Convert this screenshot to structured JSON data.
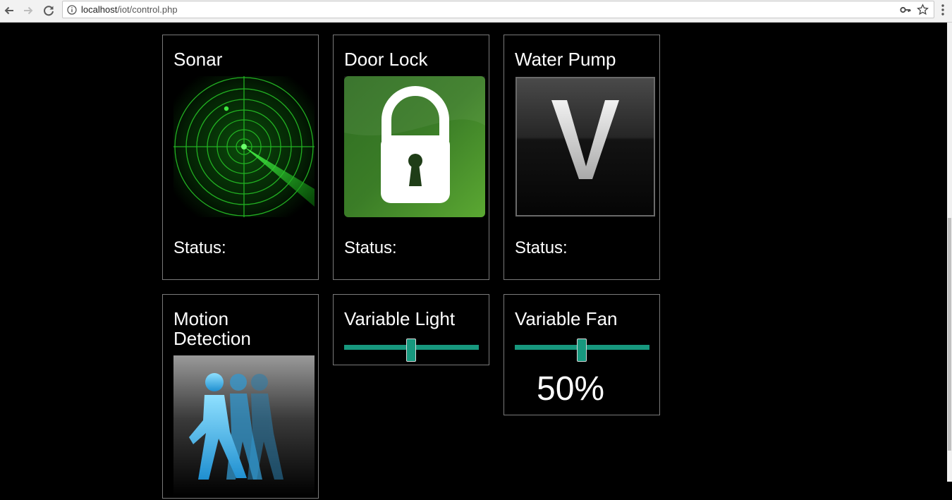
{
  "browser": {
    "url_host": "localhost",
    "url_path": "/iot/control.php",
    "icons": [
      "back-arrow-icon",
      "forward-arrow-icon",
      "reload-icon",
      "info-icon",
      "key-icon",
      "star-icon",
      "kebab-menu-icon"
    ]
  },
  "cards": {
    "sonar": {
      "title": "Sonar",
      "status_label": "Status:",
      "icon": "radar-icon"
    },
    "door_lock": {
      "title": "Door Lock",
      "status_label": "Status:",
      "icon": "padlock-icon"
    },
    "water_pump": {
      "title": "Water Pump",
      "status_label": "Status:",
      "icon": "letter-v-icon"
    },
    "motion": {
      "title_line1": "Motion",
      "title_line2": "Detection",
      "icon": "running-people-icon"
    },
    "variable_light": {
      "title": "Variable Light",
      "level_fraction": 0.5
    },
    "variable_fan": {
      "title": "Variable Fan",
      "level_fraction": 0.5,
      "value_text": "50%"
    }
  },
  "colors": {
    "page_bg": "#000000",
    "card_border": "#7a7a7a",
    "slider_accent": "#17987e",
    "radar_green": "#2ed12e",
    "lock_green": "#3f8a2a",
    "motion_blue": "#3cb6f0"
  }
}
